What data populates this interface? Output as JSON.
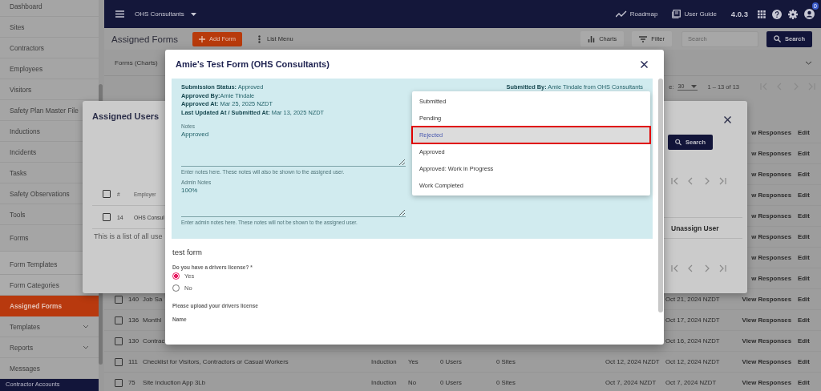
{
  "sidebar": {
    "items": [
      {
        "label": "Dashboard",
        "selected": false
      },
      {
        "label": "Sites",
        "selected": false
      },
      {
        "label": "Contractors",
        "selected": false
      },
      {
        "label": "Employees",
        "selected": false
      },
      {
        "label": "Visitors",
        "selected": false
      },
      {
        "label": "Safety Plan Master File",
        "selected": false
      },
      {
        "label": "Inductions",
        "selected": false
      },
      {
        "label": "Incidents",
        "selected": false
      },
      {
        "label": "Tasks",
        "selected": false
      },
      {
        "label": "Safety Observations",
        "selected": false
      },
      {
        "label": "Tools",
        "selected": false
      },
      {
        "label": "Forms",
        "selected": false,
        "expanded": true,
        "children": [
          {
            "label": "Form Templates",
            "selected": false
          },
          {
            "label": "Form Categories",
            "selected": false
          },
          {
            "label": "Assigned Forms",
            "selected": true
          }
        ]
      },
      {
        "label": "Templates",
        "selected": false,
        "expanded": false
      },
      {
        "label": "Reports",
        "selected": false,
        "expanded": false
      },
      {
        "label": "Messages",
        "selected": false
      }
    ],
    "footer": [
      "Contractor Accounts"
    ]
  },
  "topbar": {
    "organization": "OHS Consultants",
    "links": [
      "Roadmap",
      "User Guide"
    ],
    "version": "4.0.3",
    "notification_count": "0"
  },
  "page": {
    "title": "Assigned Forms",
    "add_button": "Add Form",
    "menu_button": "List Menu",
    "charts_button": "Charts",
    "filter_button": "Filter",
    "search": {
      "placeholder": "Search"
    },
    "search_button": "Search",
    "tab": "Forms (Charts)"
  },
  "pagination": {
    "rows_label": "e:",
    "rows_per_page": "30",
    "range": "1 – 13 of 13"
  },
  "table": {
    "rows": [
      {
        "view_link": "w Responses",
        "edit_link": "Edit"
      },
      {
        "view_link": "w Responses",
        "edit_link": "Edit"
      },
      {
        "view_link": "w Responses",
        "edit_link": "Edit"
      },
      {
        "view_link": "w Responses",
        "edit_link": "Edit"
      },
      {
        "view_link": "w Responses",
        "edit_link": "Edit"
      },
      {
        "view_link": "w Responses",
        "edit_link": "Edit"
      },
      {
        "view_link": "w Responses",
        "edit_link": "Edit"
      },
      {
        "view_link": "w Responses",
        "edit_link": "Edit"
      },
      {
        "checked": false,
        "number": "140",
        "title": "Job Sa",
        "date_2": "Oct 21, 2024 NZDT",
        "view_link": "View Responses",
        "edit_link": "Edit"
      },
      {
        "checked": false,
        "number": "136",
        "title": "Monthl",
        "date_2": "Oct 17, 2024 NZDT",
        "view_link": "View Responses",
        "edit_link": "Edit"
      },
      {
        "checked": false,
        "number": "130",
        "title": "Contrac",
        "date_2": "Oct 16, 2024 NZDT",
        "view_link": "View Responses",
        "edit_link": "Edit"
      },
      {
        "checked": false,
        "number": "111",
        "title": "Checklist for Visitors, Contractors or Casual Workers",
        "category": "Induction",
        "column_6": "Yes",
        "users": "0 Users",
        "sites": "0 Sites",
        "date_1": "Oct 12, 2024 NZDT",
        "date_2": "Oct 12, 2024 NZDT",
        "view_link": "View Responses",
        "edit_link": "Edit"
      },
      {
        "checked": false,
        "number": "75",
        "title": "Site Induction App 3Lb",
        "category": "Induction",
        "column_6": "No",
        "users": "0 Users",
        "sites": "0 Sites",
        "date_1": "Oct 7, 2024 NZDT",
        "date_2": "Oct 7, 2024 NZDT",
        "view_link": "View Responses",
        "edit_link": "Edit"
      }
    ]
  },
  "assigned_users_dialog": {
    "title": "Assigned Users",
    "search_button": "Search",
    "columns": [
      "#",
      "Employer"
    ],
    "rows": [
      {
        "checked": false,
        "number": "14",
        "employer": "OHS Consul",
        "action": "Unassign User"
      }
    ],
    "header_checked": false,
    "note": "This is a list of all use"
  },
  "form_modal": {
    "title": "Amie's Test Form (OHS Consultants)",
    "status_lines": [
      {
        "label": "Submission Status:",
        "value": " Approved"
      },
      {
        "label": "Approved By:",
        "value": "Amie Tindale"
      },
      {
        "label": "Approved At:",
        "value": " Mar 25, 2025 NZDT"
      },
      {
        "label": "Last Updated At / Submitted At:",
        "value": " Mar 13, 2025 NZDT"
      }
    ],
    "submitted_by": {
      "label": "Submitted By:",
      "value": " Amie Tindale from OHS Consultants"
    },
    "notes": {
      "label": "Notes",
      "value": "Approved",
      "helper": "Enter notes here. These notes will also be shown to the assigned user."
    },
    "admin_notes": {
      "label": "Admin Notes",
      "value": "100%",
      "helper": "Enter admin notes here. These notes will not be shown to the assigned user."
    },
    "status_options": [
      {
        "label": "Submitted",
        "selected": false
      },
      {
        "label": "Pending",
        "selected": false
      },
      {
        "label": "Rejected",
        "selected": true
      },
      {
        "label": "Approved",
        "selected": false
      },
      {
        "label": "Approved: Work in Progress",
        "selected": false
      },
      {
        "label": "Work Completed",
        "selected": false
      }
    ],
    "form_title": "test form",
    "question": "Do you have a drivers license? *",
    "answers": [
      {
        "label": "Yes",
        "selected": true
      },
      {
        "label": "No",
        "selected": false
      }
    ],
    "upload_label": "Please upload your drivers license",
    "name_label": "Name"
  }
}
